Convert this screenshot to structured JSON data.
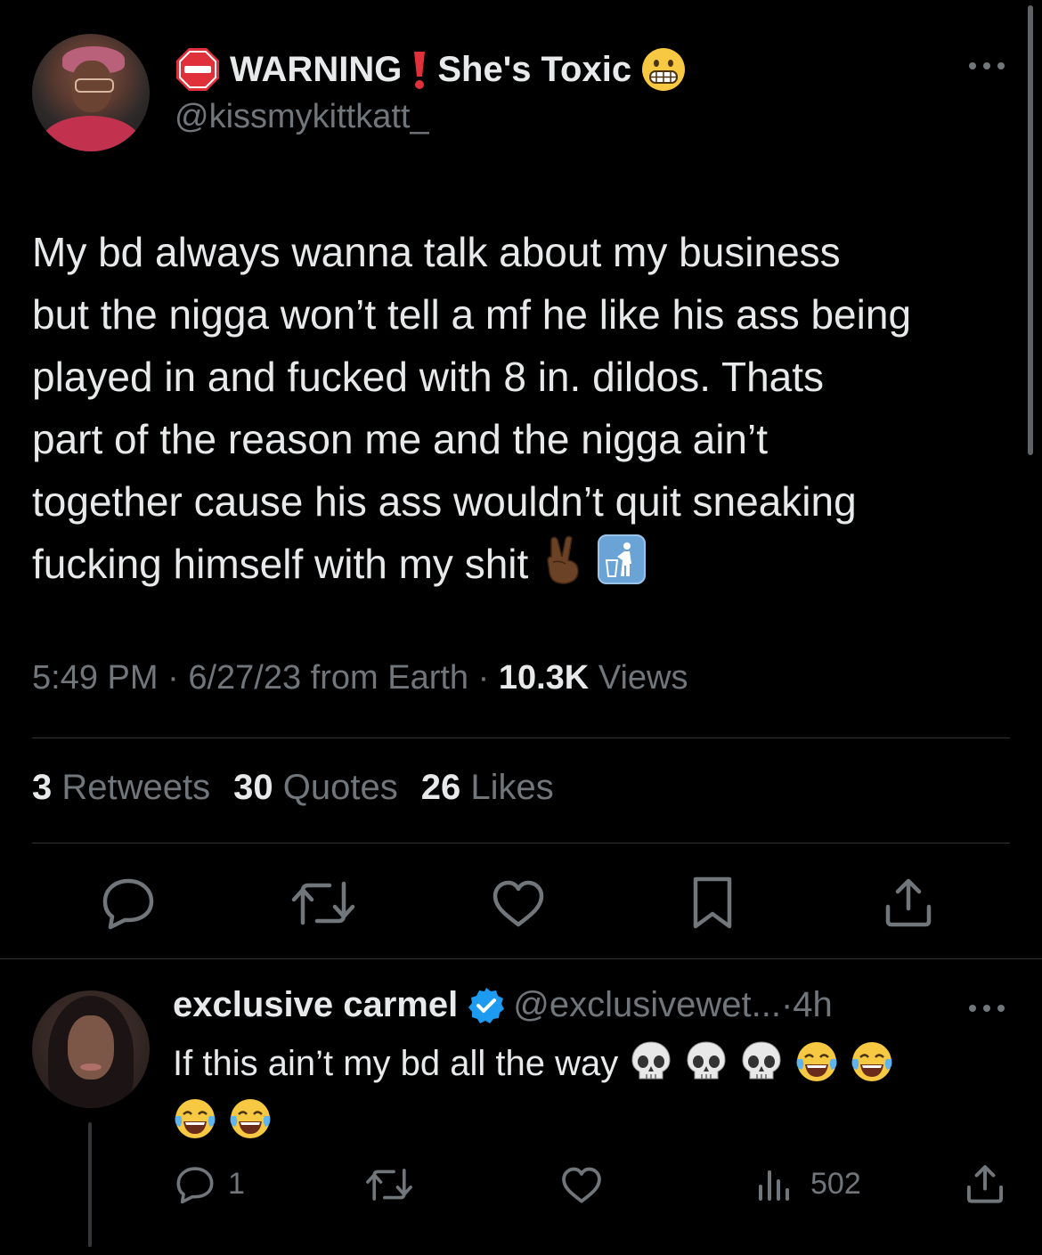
{
  "main_tweet": {
    "display_name": "WARNING",
    "display_name_suffix": "She's Toxic",
    "handle": "@kissmykittkatt_",
    "text_lines": [
      "My bd always wanna talk about my business",
      "but the nigga won’t tell a mf he like his ass being",
      "played in and fucked with 8 in. dildos. Thats",
      "part of the reason me and the nigga ain’t",
      "together cause his ass wouldn’t quit sneaking",
      "fucking himself with my shit"
    ],
    "time": "5:49 PM",
    "date": "6/27/23",
    "source": "from Earth",
    "views_count": "10.3K",
    "views_label": "Views",
    "retweets_count": "3",
    "retweets_label": "Retweets",
    "quotes_count": "30",
    "quotes_label": "Quotes",
    "likes_count": "26",
    "likes_label": "Likes",
    "icons": [
      "stop-sign-icon",
      "red-exclamation-icon",
      "grimacing-face-icon",
      "victory-hand-icon",
      "put-litter-in-bin-icon"
    ]
  },
  "reply": {
    "display_name": "exclusive carmel",
    "handle": "@exclusivewet...",
    "time": "4h",
    "text_line1": "If this ain’t  my bd all the way",
    "replies_count": "1",
    "views_count": "502"
  },
  "separators": {
    "dot": " · "
  },
  "colors": {
    "background": "#000000",
    "primary_text": "#e7e9ea",
    "secondary_text": "#71767b",
    "divider": "#2f3336",
    "verified": "#1d9bf0"
  }
}
